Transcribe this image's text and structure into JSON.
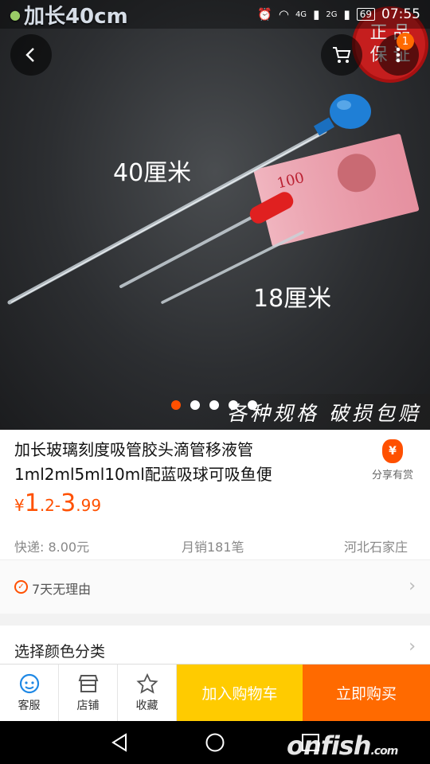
{
  "status": {
    "caption": "加长40cm",
    "network_4g": "4G",
    "network_2g": "2G",
    "battery": "69",
    "time": "07:55"
  },
  "header": {
    "cart_badge": "1",
    "seal_line1": "正 品",
    "seal_line2": "保 证"
  },
  "hero": {
    "label_long": "40厘米",
    "label_short": "18厘米",
    "banner": "各种规格 破损包赔",
    "slides_total": 5,
    "slide_active": 1,
    "bill_text": "100"
  },
  "product": {
    "title": "加长玻璃刻度吸管胶头滴管移液管1ml2ml5ml10ml配蓝吸球可吸鱼便",
    "share_label": "分享有赏",
    "price_symbol": "¥",
    "price_min_int": "1",
    "price_min_dec": ".2",
    "price_sep": "-",
    "price_max_int": "3",
    "price_max_dec": ".99",
    "shipping": "快递: 8.00元",
    "sales": "月销181笔",
    "location": "河北石家庄"
  },
  "services": {
    "return_policy": "7天无理由"
  },
  "sku": {
    "select_label": "选择颜色分类"
  },
  "bottom_bar": {
    "service_label": "客服",
    "shop_label": "店铺",
    "fav_label": "收藏",
    "add_cart_label": "加入购物车",
    "buy_now_label": "立即购买"
  },
  "watermark": {
    "main": "onfish",
    "suffix": ".com"
  },
  "colors": {
    "accent": "#ff5000",
    "cart_button": "#ffcb00",
    "buy_button": "#ff6a00"
  },
  "icons": [
    "back-icon",
    "cart-icon",
    "more-icon",
    "share-gift-icon",
    "check-circle-icon",
    "chevron-right-icon",
    "service-icon",
    "shop-icon",
    "star-icon",
    "nav-back-icon",
    "nav-home-icon",
    "nav-recent-icon"
  ]
}
